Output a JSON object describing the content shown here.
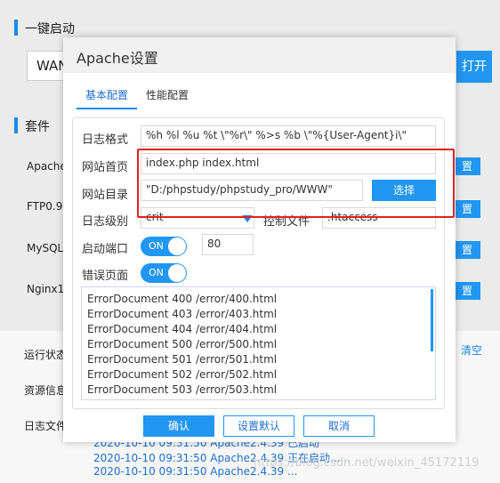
{
  "background": {
    "one_click_title": "一键启动",
    "select_value": "WAN",
    "open_button": "打开",
    "suite_title": "套件",
    "suite_rows": [
      "Apache",
      "FTP0.9.",
      "MySQL",
      "Nginx1"
    ],
    "suite_row_button": "置",
    "side_labels": [
      "运行状态",
      "资源信息",
      "日志文件"
    ],
    "clear_link": "清空",
    "log_lines": [
      "2020-10-10 09:31:50 Apache2.4.39 已启动",
      "2020-10-10 09:31:50 Apache2.4.39 正在启动......",
      "2020-10-10 09:31:50 Apache2.4.39 ..."
    ],
    "watermark": "https://blog.csdn.net/weixin_45172119"
  },
  "modal": {
    "title": "Apache设置",
    "tabs": [
      {
        "label": "基本配置",
        "active": true
      },
      {
        "label": "性能配置",
        "active": false
      }
    ],
    "fields": {
      "log_format": {
        "label": "日志格式",
        "value": "%h %l %u %t \\\"%r\\\" %>s %b \\\"%{User-Agent}i\\\""
      },
      "index": {
        "label": "网站首页",
        "value": "index.php index.html"
      },
      "web_dir": {
        "label": "网站目录",
        "value": "\"D:/phpstudy/phpstudy_pro/WWW\"",
        "button": "选择"
      },
      "log_level": {
        "label": "日志级别",
        "value": "crit"
      },
      "control_file": {
        "label": "控制文件",
        "value": ".htaccess"
      },
      "port": {
        "label": "启动端口",
        "toggle": "ON",
        "value": "80"
      },
      "error_page": {
        "label": "错误页面",
        "toggle": "ON"
      }
    },
    "error_documents": [
      "ErrorDocument 400 /error/400.html",
      "ErrorDocument 403 /error/403.html",
      "ErrorDocument 404 /error/404.html",
      "ErrorDocument 500 /error/500.html",
      "ErrorDocument 501 /error/501.html",
      "ErrorDocument 502 /error/502.html",
      "ErrorDocument 503 /error/503.html"
    ],
    "buttons": {
      "confirm": "确认",
      "default": "设置默认",
      "cancel": "取消"
    }
  },
  "colors": {
    "accent": "#2196f3",
    "highlight": "#e02020"
  }
}
